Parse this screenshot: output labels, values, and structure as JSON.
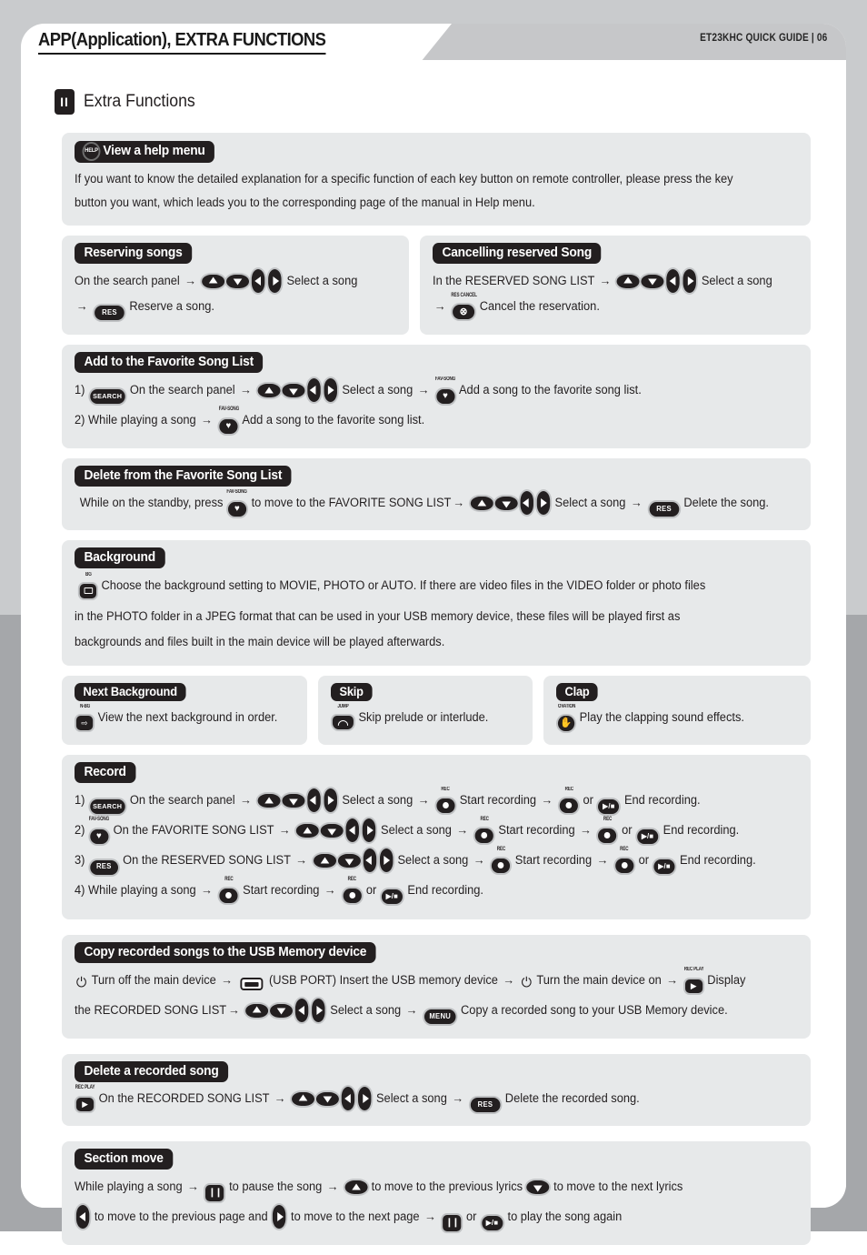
{
  "header": {
    "title": "APP(Application), EXTRA FUNCTIONS",
    "guide_label": "ET23KHC QUICK GUIDE | 06"
  },
  "section": {
    "number": "II",
    "title": "Extra Functions"
  },
  "colors": {
    "page_background": "#ffffff",
    "panel_background": "#e7e9ea",
    "pill_background": "#231f20",
    "edge_light": "#c9cbcd",
    "edge_dark": "#a5a7aa",
    "banner": "#c6c7c9",
    "text": "#231f20"
  },
  "panels": {
    "help": {
      "pill_label": "View a help menu",
      "pill_icon": "help-key-icon",
      "pill_icon_label": "HELP",
      "body_line1": "If you want to know the detailed explanation for a specific function of each key button on remote controller, please press the key",
      "body_line2": "button you want, which leads you to the corresponding page of the manual in Help menu."
    },
    "reserving": {
      "pill_label": "Reserving songs",
      "l1_a": "On the search panel",
      "l1_b": "Select a song",
      "l2_a": "Reserve a song.",
      "key_res": "RES"
    },
    "cancelling": {
      "pill_label": "Cancelling reserved Song",
      "l1_a": "In the RESERVED SONG LIST",
      "l1_b": "Select a song",
      "l2_a": "Cancel the reservation.",
      "key_cap": "RES CANCEL"
    },
    "add_favorite": {
      "pill_label": "Add to the Favorite Song List",
      "l1_num": "1)",
      "l1_key": "SEARCH",
      "l1_a": "On the search panel",
      "l1_b": "Select a song",
      "l1_c": "Add a song to the favorite song list.",
      "l2_num": "2)",
      "l2_a": "While playing a song",
      "l2_b": "Add a song to the favorite song list.",
      "fav_cap": "FAV-SONG"
    },
    "delete_favorite": {
      "pill_label": "Delete from the Favorite Song List",
      "l1_a": "While on the standby, press",
      "l1_b": "to move to the FAVORITE SONG LIST",
      "l1_c": "Select a song",
      "l1_d": "Delete the song.",
      "fav_cap": "FAV-SONG",
      "key_res": "RES"
    },
    "background": {
      "pill_label": "Background",
      "bg_cap": "BG",
      "line1": "Choose the background setting to MOVIE, PHOTO or AUTO. If there are video files in the VIDEO folder or photo files",
      "line2": "in the PHOTO folder in a JPEG format that can be used in your USB memory device, these files will be played first as",
      "line3": "backgrounds and files built in the main device will be played afterwards."
    },
    "next_background": {
      "pill_label": "Next Background",
      "cap": "N-BG",
      "text": "View the next background in order."
    },
    "skip": {
      "pill_label": "Skip",
      "cap": "JUMP",
      "text": "Skip prelude or interlude."
    },
    "clap": {
      "pill_label": "Clap",
      "cap": "OVATION",
      "text": "Play the clapping sound effects."
    },
    "record": {
      "pill_label": "Record",
      "rec_cap": "REC",
      "fav_cap": "FAV-SONG",
      "rows": [
        {
          "num": "1)",
          "key": "SEARCH",
          "a": "On the search panel",
          "b": "Select a song",
          "c": "Start recording",
          "d": "or",
          "e": "End recording."
        },
        {
          "num": "2)",
          "key": "FAV-SONG",
          "a": "On the FAVORITE SONG LIST",
          "b": "Select a song",
          "c": "Start recording",
          "d": "or",
          "e": "End recording."
        },
        {
          "num": "3)",
          "key": "RES",
          "a": "On the RESERVED SONG LIST",
          "b": "Select a song",
          "c": "Start recording",
          "d": "or",
          "e": "End recording."
        },
        {
          "num": "4)",
          "key": "",
          "a": "While playing a song",
          "b": "",
          "c": "Start recording",
          "d": "or",
          "e": "End recording."
        }
      ]
    },
    "copy_usb": {
      "pill_label": "Copy recorded songs to the USB Memory device",
      "rec_play_cap": "REC PLAY",
      "l1_a": "Turn off the main device",
      "l1_b": "(USB PORT) Insert the USB memory device",
      "l1_c": "Turn the main device on",
      "l1_d": "Display",
      "l2_a": "the RECORDED  SONG LIST",
      "l2_b": "Select a song",
      "l2_c": "Copy a recorded song to your USB Memory device.",
      "key_menu": "MENU"
    },
    "delete_recorded": {
      "pill_label": "Delete a recorded song",
      "rec_play_cap": "REC PLAY",
      "l1_a": "On the RECORDED SONG LIST",
      "l1_b": "Select a song",
      "l1_c": "Delete the recorded song.",
      "key_res": "RES"
    },
    "section_move": {
      "pill_label": "Section move",
      "l1_a": "While playing a song",
      "l1_b": "to pause the song",
      "l1_c": "to move to the previous lyrics",
      "l1_d": "to move to the next lyrics",
      "l2_a": "to move to the previous page and",
      "l2_b": "to move to the next page",
      "l2_c": "or",
      "l2_d": "to play the song again"
    }
  },
  "symbols": {
    "arrow": "→"
  }
}
